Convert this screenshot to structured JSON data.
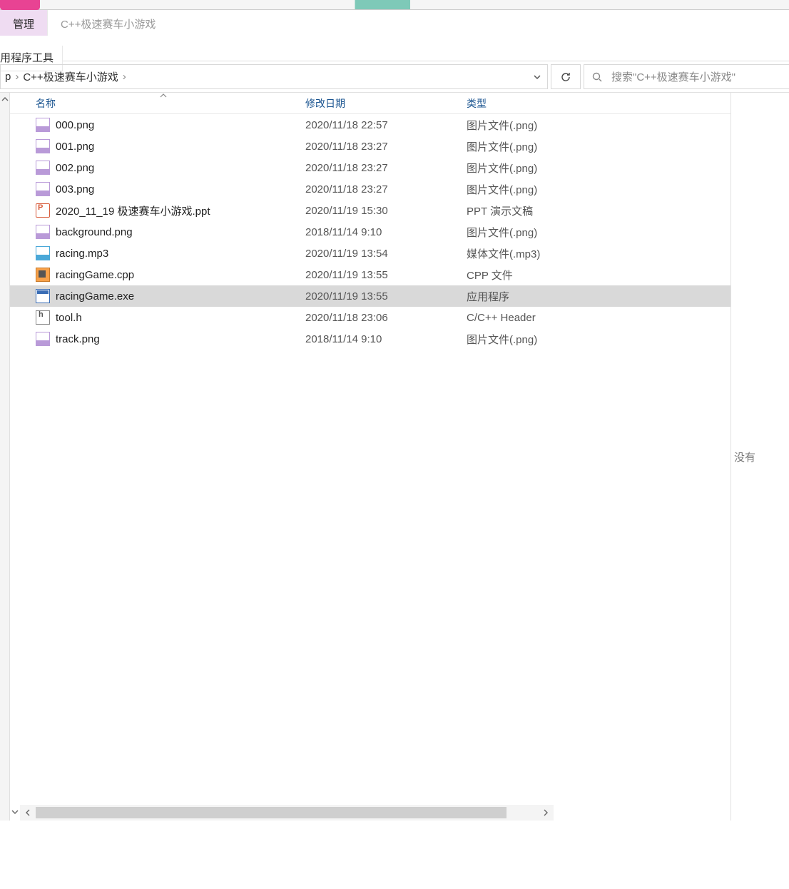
{
  "ribbon": {
    "tab_manage": "管理",
    "window_title": "C++极速赛车小游戏",
    "tool_group": "用程序工具"
  },
  "addressbar": {
    "crumb_prefix": "p",
    "folder": "C++极速赛车小游戏"
  },
  "search": {
    "placeholder": "搜索\"C++极速赛车小游戏\""
  },
  "columns": {
    "name": "名称",
    "date": "修改日期",
    "type": "类型"
  },
  "files": [
    {
      "icon": "png",
      "name": "000.png",
      "date": "2020/11/18 22:57",
      "type": "图片文件(.png)",
      "selected": false
    },
    {
      "icon": "png",
      "name": "001.png",
      "date": "2020/11/18 23:27",
      "type": "图片文件(.png)",
      "selected": false
    },
    {
      "icon": "png",
      "name": "002.png",
      "date": "2020/11/18 23:27",
      "type": "图片文件(.png)",
      "selected": false
    },
    {
      "icon": "png",
      "name": "003.png",
      "date": "2020/11/18 23:27",
      "type": "图片文件(.png)",
      "selected": false
    },
    {
      "icon": "ppt",
      "name": "2020_11_19 极速赛车小游戏.ppt",
      "date": "2020/11/19 15:30",
      "type": "PPT 演示文稿",
      "selected": false
    },
    {
      "icon": "png",
      "name": "background.png",
      "date": "2018/11/14 9:10",
      "type": "图片文件(.png)",
      "selected": false
    },
    {
      "icon": "mp3",
      "name": "racing.mp3",
      "date": "2020/11/19 13:54",
      "type": "媒体文件(.mp3)",
      "selected": false
    },
    {
      "icon": "cpp",
      "name": "racingGame.cpp",
      "date": "2020/11/19 13:55",
      "type": "CPP 文件",
      "selected": false
    },
    {
      "icon": "exe",
      "name": "racingGame.exe",
      "date": "2020/11/19 13:55",
      "type": "应用程序",
      "selected": true
    },
    {
      "icon": "h",
      "name": "tool.h",
      "date": "2020/11/18 23:06",
      "type": "C/C++ Header",
      "selected": false
    },
    {
      "icon": "png",
      "name": "track.png",
      "date": "2018/11/14 9:10",
      "type": "图片文件(.png)",
      "selected": false
    }
  ],
  "preview": {
    "text": "没有"
  }
}
